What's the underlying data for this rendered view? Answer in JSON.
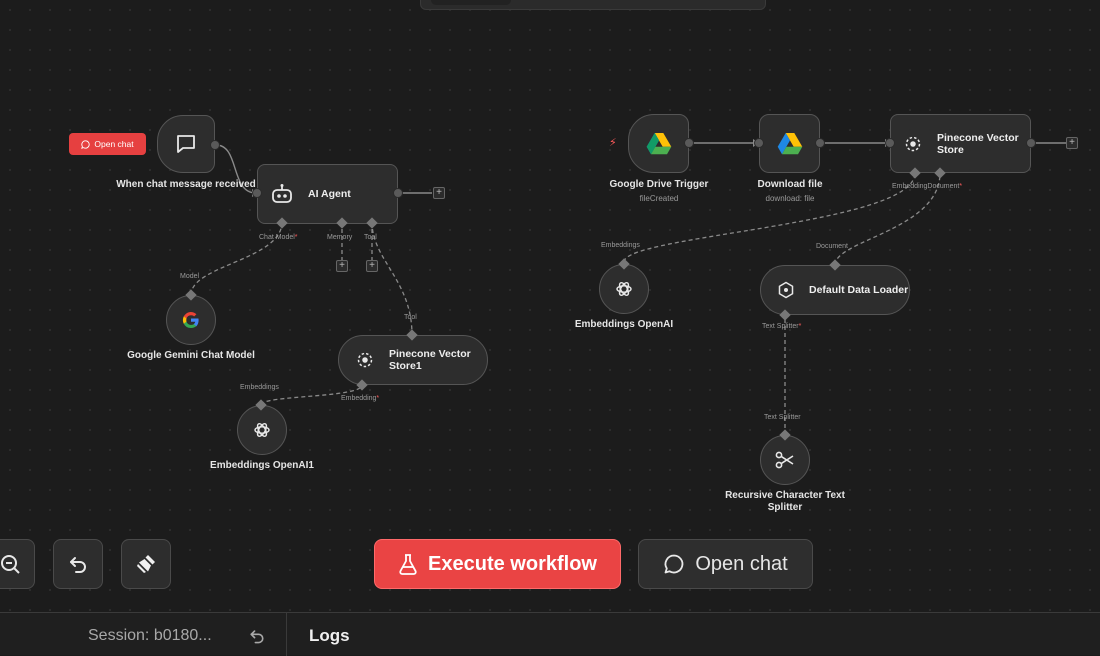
{
  "nodes": {
    "chat_trigger": {
      "label": "When chat message received",
      "tag": "Open chat"
    },
    "ai_agent": {
      "title": "AI Agent",
      "ports": {
        "chat_model": "Chat Model",
        "memory": "Memory",
        "tool": "Tool"
      }
    },
    "gemini": {
      "label": "Google Gemini Chat Model",
      "port": "Model"
    },
    "pinecone_store1": {
      "title": "Pinecone Vector Store1",
      "port_in": "Tool",
      "port_embedding": "Embedding"
    },
    "embeddings_openai1": {
      "label": "Embeddings OpenAI1",
      "port": "Embeddings"
    },
    "drive_trigger": {
      "label": "Google Drive Trigger",
      "sub": "fileCreated"
    },
    "download_file": {
      "label": "Download file",
      "sub": "download: file"
    },
    "pinecone_store": {
      "title": "Pinecone Vector Store",
      "port_embedding": "Embedding",
      "port_document": "Document"
    },
    "embeddings_openai": {
      "label": "Embeddings OpenAI",
      "port": "Embeddings"
    },
    "data_loader": {
      "title": "Default Data Loader",
      "port_document": "Document",
      "port_splitter": "Text Splitter"
    },
    "text_splitter": {
      "label": "Recursive Character Text Splitter",
      "port": "Text Splitter"
    }
  },
  "controls": {
    "execute_label": "Execute workflow",
    "open_chat_label": "Open chat"
  },
  "footer": {
    "session": "Session: b0180...",
    "logs": "Logs"
  },
  "colors": {
    "accent": "#ea4444",
    "required": "#ff5b5b",
    "canvas": "#1c1c1c"
  }
}
